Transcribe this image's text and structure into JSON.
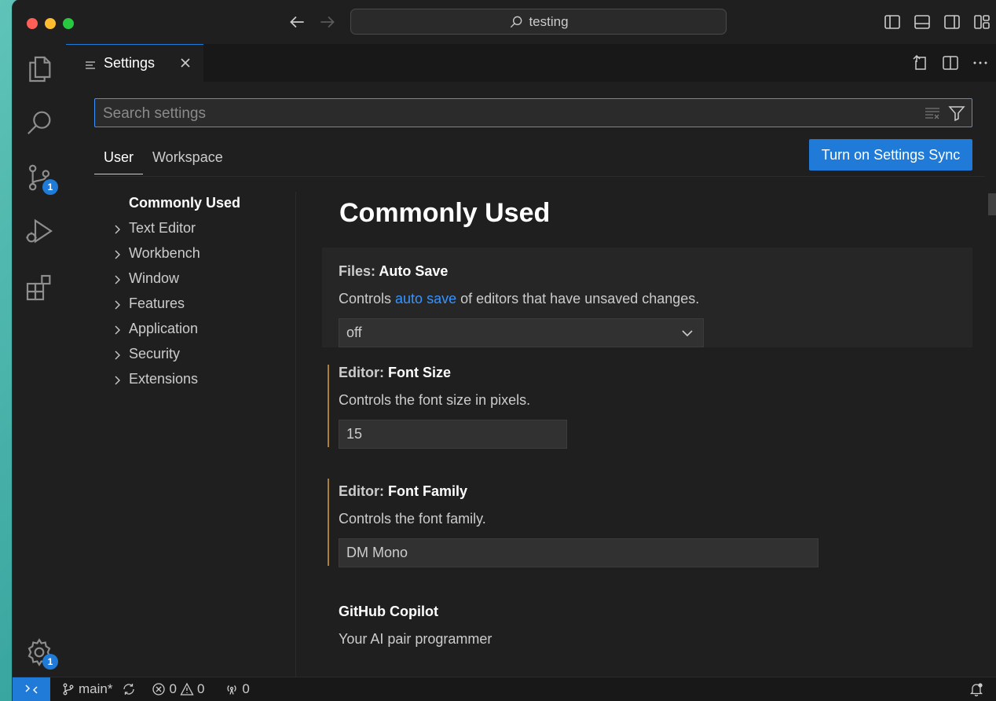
{
  "titlebar": {
    "search_text": "testing"
  },
  "activity": {
    "source_control_badge": "1",
    "manage_badge": "1"
  },
  "tab": {
    "label": "Settings"
  },
  "search": {
    "placeholder": "Search settings"
  },
  "scopes": {
    "user": "User",
    "workspace": "Workspace"
  },
  "sync_button": "Turn on Settings Sync",
  "toc": {
    "current": "Commonly Used",
    "items": [
      "Text Editor",
      "Workbench",
      "Window",
      "Features",
      "Application",
      "Security",
      "Extensions"
    ]
  },
  "content": {
    "section_title": "Commonly Used",
    "auto_save": {
      "category": "Files: ",
      "name": "Auto Save",
      "desc_pre": "Controls ",
      "desc_link": "auto save",
      "desc_post": " of editors that have unsaved changes.",
      "value": "off"
    },
    "font_size": {
      "category": "Editor: ",
      "name": "Font Size",
      "desc": "Controls the font size in pixels.",
      "value": "15"
    },
    "font_family": {
      "category": "Editor: ",
      "name": "Font Family",
      "desc": "Controls the font family.",
      "value": "DM Mono"
    },
    "copilot": {
      "name": "GitHub Copilot",
      "desc": "Your AI pair programmer"
    }
  },
  "statusbar": {
    "branch": "main*",
    "errors": "0",
    "warnings": "0",
    "ports": "0"
  },
  "colors": {
    "accent": "#1f7ad8",
    "link": "#3794ff",
    "modified": "#ac7f36"
  }
}
